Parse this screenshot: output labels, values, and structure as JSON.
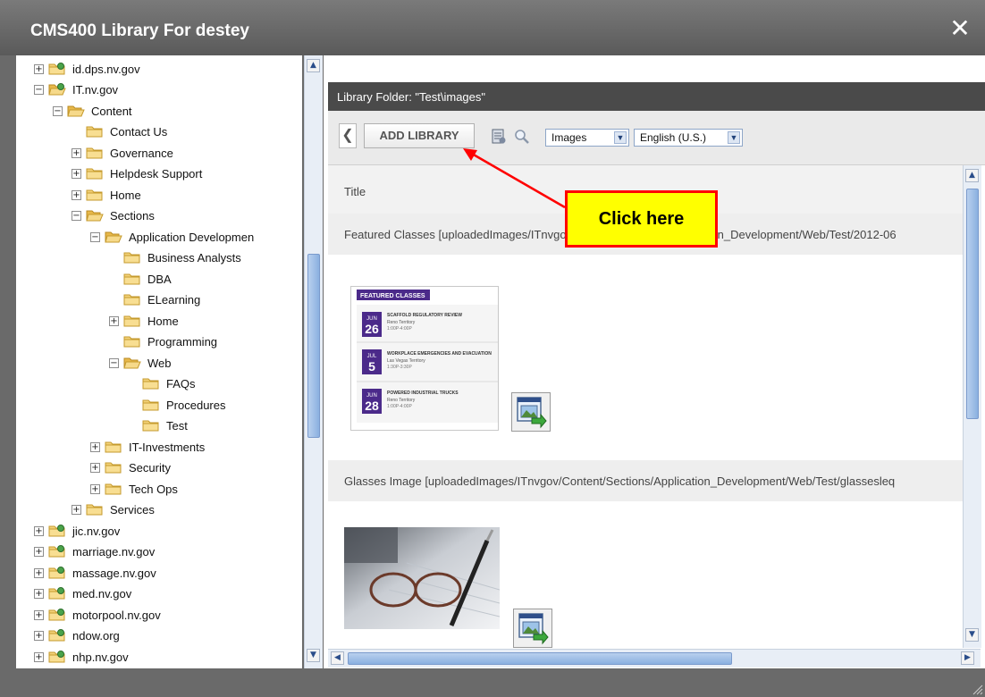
{
  "window": {
    "title": "CMS400 Library For destey",
    "close_glyph": "✕"
  },
  "tree": {
    "items": [
      {
        "label": "id.dps.nv.gov",
        "toggle": "+",
        "depth": 0,
        "folder": "site"
      },
      {
        "label": "IT.nv.gov",
        "toggle": "−",
        "depth": 0,
        "folder": "site-open"
      },
      {
        "label": "Content",
        "toggle": "−",
        "depth": 1,
        "folder": "open"
      },
      {
        "label": "Contact Us",
        "toggle": "",
        "depth": 2,
        "folder": "closed"
      },
      {
        "label": "Governance",
        "toggle": "+",
        "depth": 2,
        "folder": "closed"
      },
      {
        "label": "Helpdesk Support",
        "toggle": "+",
        "depth": 2,
        "folder": "closed"
      },
      {
        "label": "Home",
        "toggle": "+",
        "depth": 2,
        "folder": "closed"
      },
      {
        "label": "Sections",
        "toggle": "−",
        "depth": 2,
        "folder": "open"
      },
      {
        "label": "Application Developmen",
        "toggle": "−",
        "depth": 3,
        "folder": "open"
      },
      {
        "label": "Business Analysts",
        "toggle": "",
        "depth": 4,
        "folder": "closed"
      },
      {
        "label": "DBA",
        "toggle": "",
        "depth": 4,
        "folder": "closed"
      },
      {
        "label": "ELearning",
        "toggle": "",
        "depth": 4,
        "folder": "closed"
      },
      {
        "label": "Home",
        "toggle": "+",
        "depth": 4,
        "folder": "closed"
      },
      {
        "label": "Programming",
        "toggle": "",
        "depth": 4,
        "folder": "closed"
      },
      {
        "label": "Web",
        "toggle": "−",
        "depth": 4,
        "folder": "open"
      },
      {
        "label": "FAQs",
        "toggle": "",
        "depth": 5,
        "folder": "closed"
      },
      {
        "label": "Procedures",
        "toggle": "",
        "depth": 5,
        "folder": "closed"
      },
      {
        "label": "Test",
        "toggle": "",
        "depth": 5,
        "folder": "closed"
      },
      {
        "label": "IT-Investments",
        "toggle": "+",
        "depth": 3,
        "folder": "closed"
      },
      {
        "label": "Security",
        "toggle": "+",
        "depth": 3,
        "folder": "closed"
      },
      {
        "label": "Tech Ops",
        "toggle": "+",
        "depth": 3,
        "folder": "closed"
      },
      {
        "label": "Services",
        "toggle": "+",
        "depth": 2,
        "folder": "closed"
      },
      {
        "label": "jic.nv.gov",
        "toggle": "+",
        "depth": 0,
        "folder": "site"
      },
      {
        "label": "marriage.nv.gov",
        "toggle": "+",
        "depth": 0,
        "folder": "site"
      },
      {
        "label": "massage.nv.gov",
        "toggle": "+",
        "depth": 0,
        "folder": "site"
      },
      {
        "label": "med.nv.gov",
        "toggle": "+",
        "depth": 0,
        "folder": "site"
      },
      {
        "label": "motorpool.nv.gov",
        "toggle": "+",
        "depth": 0,
        "folder": "site"
      },
      {
        "label": "ndow.org",
        "toggle": "+",
        "depth": 0,
        "folder": "site"
      },
      {
        "label": "nhp.nv.gov",
        "toggle": "+",
        "depth": 0,
        "folder": "site"
      }
    ]
  },
  "library": {
    "folder_label": "Library Folder: \"Test\\images\"",
    "back_glyph": "❮",
    "add_library_label": "ADD LIBRARY",
    "type_select": "Images",
    "language_select": "English (U.S.)",
    "title_header": "Title",
    "rows": [
      {
        "title": "Featured Classes [uploadedImages/ITnvgov/Content/Sections/Application_Development/Web/Test/2012-06"
      },
      {
        "title": "Glasses Image [uploadedImages/ITnvgov/Content/Sections/Application_Development/Web/Test/glassesleq"
      }
    ]
  },
  "featured_card": {
    "header": "FEATURED CLASSES",
    "events": [
      {
        "month": "JUN",
        "day": "26",
        "title": "SCAFFOLD REGULATORY REVIEW",
        "place": "Reno Territory",
        "time": "1:00P-4:00P"
      },
      {
        "month": "JUL",
        "day": "5",
        "title": "WORKPLACE EMERGENCIES AND EVACUATION",
        "place": "Las Vegas Territory",
        "time": "1:30P-3:30P"
      },
      {
        "month": "JUN",
        "day": "28",
        "title": "POWERED INDUSTRIAL TRUCKS",
        "place": "Reno Territory",
        "time": "1:00P-4:00P"
      }
    ]
  },
  "annotation": {
    "callout_text": "Click here"
  },
  "colors": {
    "accent_purple": "#4b2a8a",
    "callout_bg": "#ffff00",
    "callout_border": "#ff0000"
  }
}
